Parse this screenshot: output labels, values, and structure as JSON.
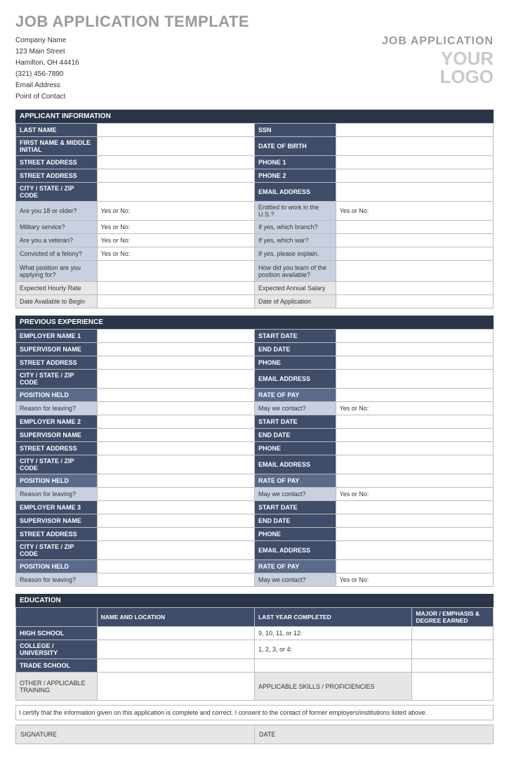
{
  "title": "JOB APPLICATION TEMPLATE",
  "company": {
    "name": "Company Name",
    "street": "123 Main Street",
    "city": "Hamilton, OH 44416",
    "phone": "(321) 456-7890",
    "email": "Email Address",
    "poc": "Point of Contact"
  },
  "header": {
    "jobapp": "JOB APPLICATION",
    "logo1": "YOUR",
    "logo2": "LOGO"
  },
  "sections": {
    "applicant": "APPLICANT INFORMATION",
    "previous": "PREVIOUS EXPERIENCE",
    "education": "EDUCATION"
  },
  "applicant": {
    "last_name": "LAST NAME",
    "ssn": "SSN",
    "first_name": "FIRST NAME & MIDDLE INITIAL",
    "dob": "DATE OF BIRTH",
    "street1": "STREET ADDRESS",
    "phone1": "PHONE 1",
    "street2": "STREET ADDRESS",
    "phone2": "PHONE 2",
    "csz": "CITY / STATE / ZIP CODE",
    "email": "EMAIL ADDRESS",
    "q_18": "Are you 18 or older?",
    "q_entitled": "Entitled to work in the U.S.?",
    "q_military": "Military service?",
    "q_branch": "If yes, which branch?",
    "q_veteran": "Are you a veteran?",
    "q_war": "If yes, which war?",
    "q_felony": "Convicted of a felony?",
    "q_explain": "If yes, please explain.",
    "q_position": "What position are you applying for?",
    "q_learn": "How did you learn of the position available?",
    "hourly": "Expected Hourly Rate",
    "salary": "Expected Annual Salary",
    "avail": "Date Available to Begin",
    "appdate": "Date of Application",
    "yesno": "Yes or No:"
  },
  "exp": {
    "emp": [
      "EMPLOYER NAME 1",
      "EMPLOYER NAME 2",
      "EMPLOYER NAME 3"
    ],
    "supervisor": "SUPERVISOR NAME",
    "street": "STREET ADDRESS",
    "csz": "CITY / STATE / ZIP CODE",
    "position": "POSITION HELD",
    "reason": "Reason for leaving?",
    "start": "START DATE",
    "end": "END DATE",
    "phone": "PHONE",
    "email": "EMAIL ADDRESS",
    "rate": "RATE OF PAY",
    "contact": "May we contact?",
    "yesno": "Yes or No:"
  },
  "edu": {
    "h_name": "NAME AND LOCATION",
    "h_year": "LAST YEAR COMPLETED",
    "h_major": "MAJOR / EMPHASIS & DEGREE EARNED",
    "hs": "HIGH SCHOOL",
    "hs_y": "9, 10, 11, or 12:",
    "col": "COLLEGE / UNIVERSITY",
    "col_y": "1, 2, 3, or 4:",
    "trade": "TRADE SCHOOL",
    "other": "OTHER / APPLICABLE TRAINING",
    "skills": "APPLICABLE SKILLS / PROFICIENCIES"
  },
  "cert": "I certify that the information given on this application is complete and correct. I consent to the contact of former employers/institutions listed above.",
  "sig": "SIGNATURE",
  "date": "DATE"
}
